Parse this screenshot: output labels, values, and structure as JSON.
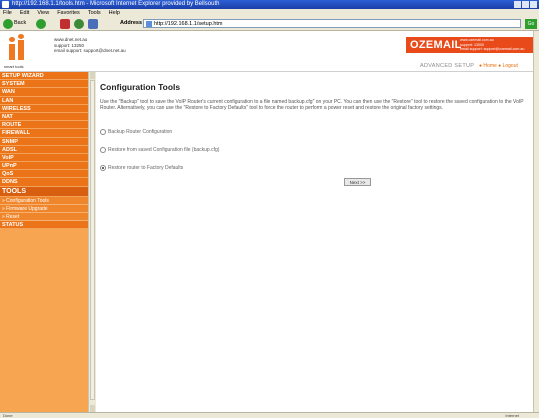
{
  "browser": {
    "title": "http://192.168.1.1/tools.htm - Microsoft Internet Explorer provided by Bellsouth",
    "menu": [
      "File",
      "Edit",
      "View",
      "Favorites",
      "Tools",
      "Help"
    ],
    "back_label": "Back",
    "address_label": "Address",
    "address_value": "http://192.168.1.1/setup.htm",
    "go_label": "Go",
    "status_text": "Done",
    "zone_text": "Internet"
  },
  "header": {
    "logo_caption": "smart tools",
    "contact_lines": [
      "www.dnet.net.au",
      "support: 13250",
      "email support: support@dnet.net.au"
    ],
    "brand": "OZEMAIL",
    "brand_lines": [
      "www.ozemail.com.au",
      "support: 13000",
      "email support: support@ozemail.com.au"
    ],
    "advanced_setup": "ADVANCED SETUP",
    "home_link": "Home",
    "logout_link": "Logout"
  },
  "sidebar": {
    "items": [
      {
        "label": "SETUP WIZARD"
      },
      {
        "label": "SYSTEM"
      },
      {
        "label": "WAN"
      },
      {
        "label": "LAN"
      },
      {
        "label": "WIRELESS"
      },
      {
        "label": "NAT"
      },
      {
        "label": "ROUTE"
      },
      {
        "label": "FIREWALL"
      },
      {
        "label": "SNMP"
      },
      {
        "label": "ADSL"
      },
      {
        "label": "VoIP"
      },
      {
        "label": "UPnP"
      },
      {
        "label": "QoS"
      },
      {
        "label": "DDNS"
      }
    ],
    "active": "TOOLS",
    "subitems": [
      {
        "label": "» Configuration Tools"
      },
      {
        "label": "» Firmware Upgrade"
      },
      {
        "label": "» Reset"
      }
    ],
    "status": "STATUS"
  },
  "main": {
    "heading": "Configuration Tools",
    "description": "Use the \"Backup\" tool to save the VoIP Router's current configuration to a file named backup.cfg\" on your PC. You can then use the \"Restore\" tool to restore the saved configuration to the VoIP Router. Alternatively, you can use the \"Restore to Factory Defaults\" tool to force the router to perform a power reset and restore the original factory settings.",
    "options": [
      {
        "label": "Backup Router Configuration",
        "checked": false
      },
      {
        "label": "Restore from saved Configuration file (backup.cfg)",
        "checked": false
      },
      {
        "label": "Restore router to Factory Defaults",
        "checked": true
      }
    ],
    "apply_label": "Next >>"
  }
}
